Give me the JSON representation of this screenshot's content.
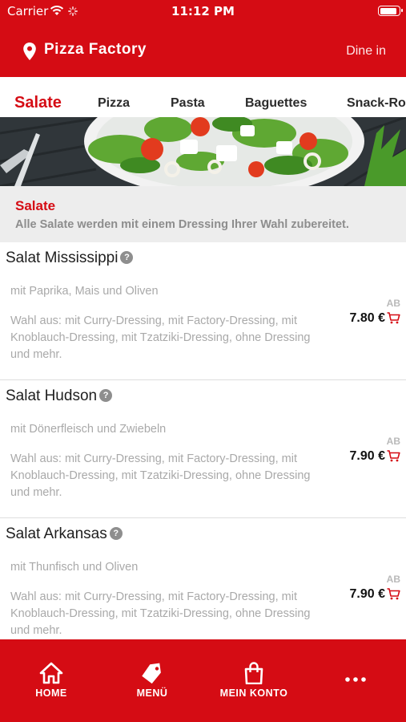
{
  "status_bar": {
    "carrier": "Carrier",
    "time": "11:12 PM"
  },
  "header": {
    "title": "Pizza Factory",
    "mode": "Dine in"
  },
  "tabs": [
    {
      "label": "Salate",
      "active": true
    },
    {
      "label": "Pizza"
    },
    {
      "label": "Pasta"
    },
    {
      "label": "Baguettes"
    },
    {
      "label": "Snack-Ro"
    }
  ],
  "category": {
    "title": "Salate",
    "description": "Alle Salate werden mit einem Dressing Ihrer Wahl zubereitet."
  },
  "items": [
    {
      "name": "Salat Mississippi",
      "subtitle": "mit Paprika, Mais und Oliven",
      "options": "Wahl aus: mit Curry-Dressing, mit Factory-Dressing, mit Knoblauch-Dressing, mit Tzatziki-Dressing, ohne Dressing und mehr.",
      "price_prefix": "AB",
      "price": "7.80 €"
    },
    {
      "name": "Salat Hudson",
      "subtitle": "mit Dönerfleisch und Zwiebeln",
      "options": "Wahl aus: mit Curry-Dressing, mit Factory-Dressing, mit Knoblauch-Dressing, mit Tzatziki-Dressing, ohne Dressing und mehr.",
      "price_prefix": "AB",
      "price": "7.90 €"
    },
    {
      "name": "Salat Arkansas",
      "subtitle": "mit Thunfisch und Oliven",
      "options": "Wahl aus: mit Curry-Dressing, mit Factory-Dressing, mit Knoblauch-Dressing, mit Tzatziki-Dressing, ohne Dressing und mehr.",
      "price_prefix": "AB",
      "price": "7.90 €"
    }
  ],
  "bottom_nav": [
    {
      "label": "HOME",
      "icon": "home-icon"
    },
    {
      "label": "MENÜ",
      "icon": "tag-icon"
    },
    {
      "label": "MEIN KONTO",
      "icon": "shopping-bag-icon"
    },
    {
      "label": "",
      "icon": "more-dots-icon"
    }
  ],
  "colors": {
    "brand_red": "#d50c14",
    "category_bg": "#ededed",
    "muted_text": "#a9a9a9"
  }
}
